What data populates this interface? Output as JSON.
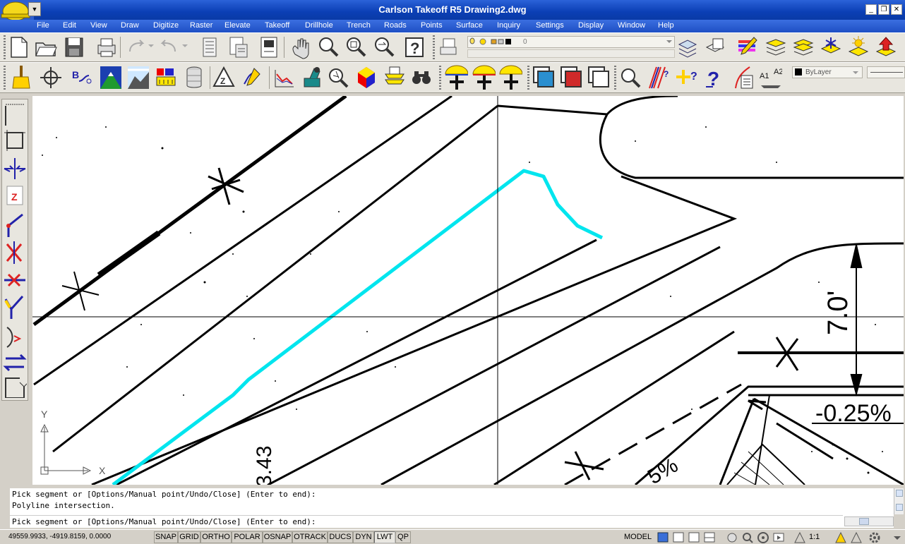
{
  "window": {
    "title": "Carlson Takeoff R5    Drawing2.dwg",
    "minimize": "_",
    "restore": "❐",
    "close": "✕"
  },
  "menu": [
    "File",
    "Edit",
    "View",
    "Draw",
    "Digitize",
    "Raster",
    "Elevate",
    "Takeoff",
    "Drillhole",
    "Trench",
    "Roads",
    "Points",
    "Surface",
    "Inquiry",
    "Settings",
    "Display",
    "Window",
    "Help"
  ],
  "layer": {
    "current": "0"
  },
  "properties": {
    "color": "ByLayer"
  },
  "drawing": {
    "dimension_text": "7.0'",
    "slope_text": "-0.25%",
    "side_text": "3.43",
    "partial_text": "5%",
    "ucs_x": "X",
    "ucs_y": "Y"
  },
  "command": {
    "history": [
      "Pick segment or [Options/Manual point/Undo/Close] (Enter to end):",
      "Polyline intersection."
    ],
    "prompt": "Pick segment or [Options/Manual point/Undo/Close] (Enter to end):"
  },
  "status": {
    "coordinates": "49559.9933, -4919.8159, 0.0000",
    "toggles": [
      {
        "label": "SNAP",
        "on": false
      },
      {
        "label": "GRID",
        "on": false
      },
      {
        "label": "ORTHO",
        "on": false
      },
      {
        "label": "POLAR",
        "on": false
      },
      {
        "label": "OSNAP",
        "on": false
      },
      {
        "label": "OTRACK",
        "on": false
      },
      {
        "label": "DUCS",
        "on": false
      },
      {
        "label": "DYN",
        "on": false
      },
      {
        "label": "LWT",
        "on": true
      },
      {
        "label": "QP",
        "on": false
      }
    ],
    "space": "MODEL",
    "annotation_scale": "1:1"
  },
  "colors": {
    "titlebar": "#0b3fb5",
    "menubar": "#1e4fc4",
    "trace_line": "#00e5ee",
    "toolbar_bg": "#e8e6df"
  }
}
